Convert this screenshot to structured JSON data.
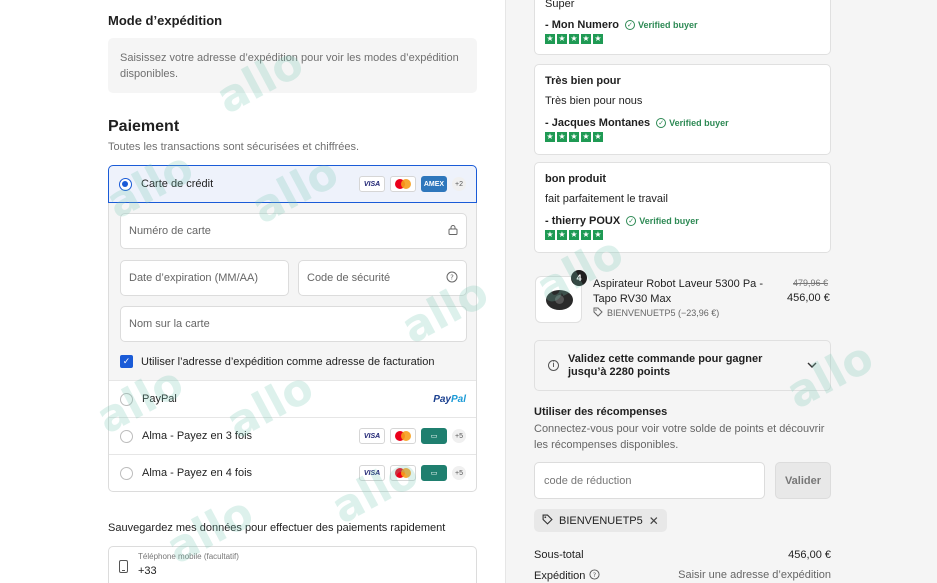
{
  "shipping": {
    "title": "Mode d’expédition",
    "info": "Saisissez votre adresse d’expédition pour voir les modes d’expédition disponibles."
  },
  "payment": {
    "title": "Paiement",
    "subtitle": "Toutes les transactions sont sécurisées et chiffrées.",
    "card_label": "Carte de crédit",
    "card_logos": [
      "VISA",
      "Mastercard",
      "AMEX"
    ],
    "card_more": "+2",
    "card_number_placeholder": "Numéro de carte",
    "expiry_placeholder": "Date d’expiration (MM/AA)",
    "security_placeholder": "Code de sécurité",
    "name_placeholder": "Nom sur la carte",
    "billing_same_label": "Utiliser l’adresse d’expédition comme adresse de facturation",
    "billing_same_checked": true,
    "paypal_label": "PayPal",
    "paypal_logo_a": "Pay",
    "paypal_logo_b": "Pal",
    "alma3_label": "Alma - Payez en 3 fois",
    "alma4_label": "Alma - Payez en 4 fois",
    "alma_more": "+5",
    "selected": "card"
  },
  "save": {
    "label": "Sauvegardez mes données pour effectuer des paiements rapidement",
    "phone_label": "Téléphone mobile (facultatif)",
    "phone_value": "+33"
  },
  "reviews": [
    {
      "title": "",
      "body": "Super",
      "author": "- Mon Numero",
      "verified": "Verified buyer",
      "rating": 5
    },
    {
      "title": "Très bien pour",
      "body": "Très bien pour nous",
      "author": "- Jacques Montanes",
      "verified": "Verified buyer",
      "rating": 5
    },
    {
      "title": "bon produit",
      "body": "fait parfaitement le travail",
      "author": "- thierry POUX",
      "verified": "Verified buyer",
      "rating": 5
    }
  ],
  "product": {
    "name_line1": "Aspirateur Robot Laveur 5300 Pa -",
    "name_line2": "Tapo RV30 Max",
    "quantity": "4",
    "discount": "BIENVENUETP5 (−23,96 €)",
    "old_price": "479,96 €",
    "price": "456,00 €"
  },
  "rewards": {
    "points_cta_line1": "Validez cette commande pour gagner",
    "points_cta_line2": "jusqu’à 2280 points",
    "title": "Utiliser des récompenses",
    "text_line1": "Connectez-vous pour voir votre solde de points et découvrir",
    "text_line2": "les récompenses disponibles.",
    "code_placeholder": "code de réduction",
    "apply_label": "Valider",
    "applied_code": "BIENVENUETP5"
  },
  "totals": {
    "subtotal_label": "Sous-total",
    "subtotal_value": "456,00 €",
    "shipping_label": "Expédition",
    "shipping_value": "Saisir une adresse d’expédition"
  },
  "watermark_text": "allo",
  "colors": {
    "accent": "#1a5bd7",
    "verified": "#2e8a55",
    "stars": "#1f9a54"
  }
}
